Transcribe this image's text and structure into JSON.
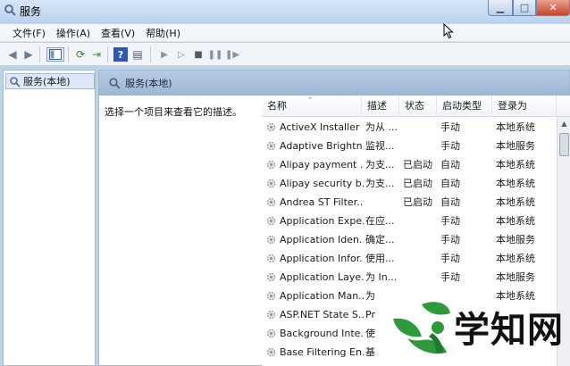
{
  "window": {
    "title": "服务",
    "icon": "gear-magnifier-icon"
  },
  "titlebar_buttons": {
    "minimize": "minimize-icon",
    "maximize": "maximize-icon",
    "close": "close-icon"
  },
  "menu": [
    {
      "label": "文件(F)"
    },
    {
      "label": "操作(A)"
    },
    {
      "label": "查看(V)"
    },
    {
      "label": "帮助(H)"
    }
  ],
  "toolbar": [
    "back-icon",
    "forward-icon",
    "show-tree-icon",
    "refresh-icon",
    "export-icon",
    "help-icon",
    "properties-icon",
    "start-icon",
    "start-alt-icon",
    "stop-icon",
    "pause-icon",
    "restart-icon"
  ],
  "tree": {
    "node_label": "服务(本地)"
  },
  "panel": {
    "header": "服务(本地)",
    "description": "选择一个项目来查看它的描述。"
  },
  "columns": [
    "名称",
    "描述",
    "状态",
    "启动类型",
    "登录为"
  ],
  "services": [
    {
      "name": "ActiveX Installer ...",
      "desc": "为从 ...",
      "status": "",
      "startup": "手动",
      "logon": "本地系统"
    },
    {
      "name": "Adaptive Brightn...",
      "desc": "监视...",
      "status": "",
      "startup": "手动",
      "logon": "本地服务"
    },
    {
      "name": "Alipay payment ...",
      "desc": "为支...",
      "status": "已启动",
      "startup": "自动",
      "logon": "本地系统"
    },
    {
      "name": "Alipay security b...",
      "desc": "为支...",
      "status": "已启动",
      "startup": "自动",
      "logon": "本地系统"
    },
    {
      "name": "Andrea ST Filter...",
      "desc": "",
      "status": "已启动",
      "startup": "自动",
      "logon": "本地系统"
    },
    {
      "name": "Application Expe...",
      "desc": "在应...",
      "status": "",
      "startup": "手动",
      "logon": "本地系统"
    },
    {
      "name": "Application Iden...",
      "desc": "确定...",
      "status": "",
      "startup": "手动",
      "logon": "本地服务"
    },
    {
      "name": "Application Infor...",
      "desc": "使用...",
      "status": "",
      "startup": "手动",
      "logon": "本地系统"
    },
    {
      "name": "Application Laye...",
      "desc": "为 In...",
      "status": "",
      "startup": "手动",
      "logon": "本地服务"
    },
    {
      "name": "Application Man...",
      "desc": "为",
      "status": "",
      "startup": "",
      "logon": "本地系统"
    },
    {
      "name": "ASP.NET State S...",
      "desc": "Pr",
      "status": "",
      "startup": "",
      "logon": ""
    },
    {
      "name": "Background Inte...",
      "desc": "使",
      "status": "",
      "startup": "",
      "logon": ""
    },
    {
      "name": "Base Filtering En...",
      "desc": "基",
      "status": "",
      "startup": "",
      "logon": ""
    }
  ],
  "watermark": {
    "text": "学知网",
    "logo": "leaf-person-logo"
  }
}
